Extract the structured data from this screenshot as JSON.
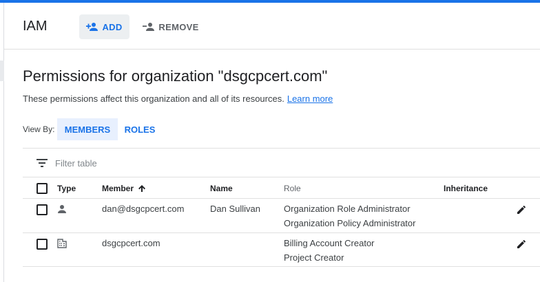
{
  "header": {
    "title": "IAM",
    "add_label": "ADD",
    "remove_label": "REMOVE"
  },
  "page": {
    "title": "Permissions for organization \"dsgcpcert.com\"",
    "description": "These permissions affect this organization and all of its resources.",
    "learn_more": "Learn more"
  },
  "view_by": {
    "label": "View By:",
    "tabs": [
      {
        "label": "MEMBERS",
        "selected": true
      },
      {
        "label": "ROLES",
        "selected": false
      }
    ]
  },
  "filter": {
    "placeholder": "Filter table"
  },
  "table": {
    "columns": {
      "type": "Type",
      "member": "Member",
      "name": "Name",
      "role": "Role",
      "inheritance": "Inheritance"
    },
    "sort": {
      "column": "member",
      "direction": "ascending"
    },
    "rows": [
      {
        "type_icon": "person-icon",
        "member": "dan@dsgcpcert.com",
        "name": "Dan Sullivan",
        "roles": [
          "Organization Role Administrator",
          "Organization Policy Administrator"
        ],
        "inheritance": ""
      },
      {
        "type_icon": "domain-icon",
        "member": "dsgcpcert.com",
        "name": "",
        "roles": [
          "Billing Account Creator",
          "Project Creator"
        ],
        "inheritance": ""
      }
    ]
  },
  "colors": {
    "accent": "#1a73e8",
    "selected_tab_bg": "#e8f0fe",
    "button_bg": "#eceff1"
  }
}
